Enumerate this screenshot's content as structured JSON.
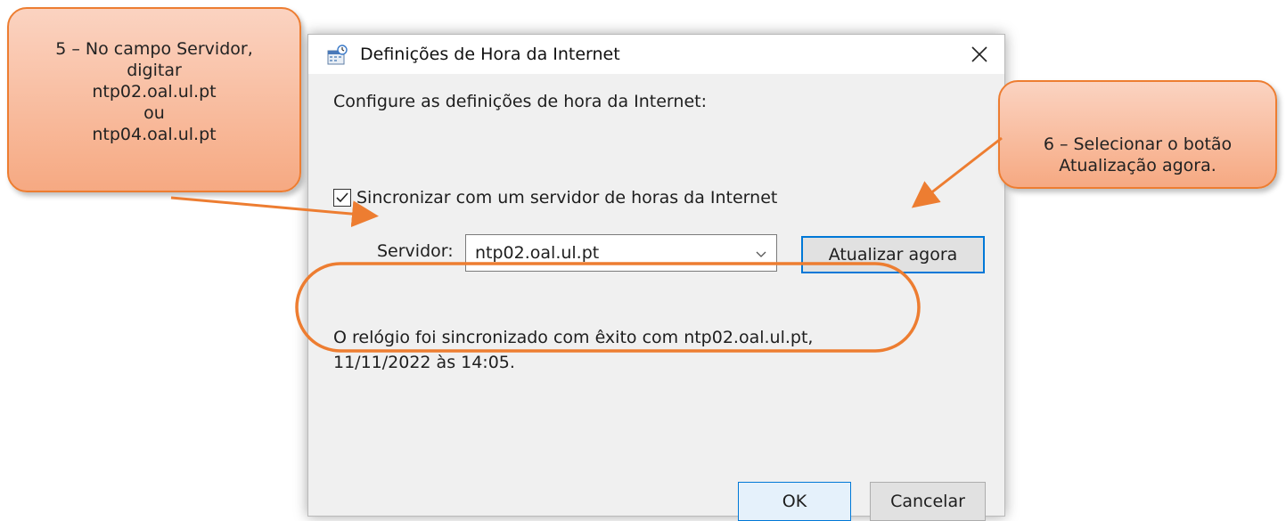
{
  "dialog": {
    "title": "Definições de Hora da Internet",
    "close_label": "✕",
    "intro_text": "Configure as definições de hora da Internet:",
    "sync_checkbox": {
      "label": "Sincronizar com um servidor de horas da Internet",
      "checked": true
    },
    "server_label": "Servidor:",
    "server_value": "ntp02.oal.ul.pt",
    "update_button": "Atualizar agora",
    "status_line1": "O relógio foi sincronizado com êxito com ntp02.oal.ul.pt,",
    "status_line2": "11/11/2022 às 14:05.",
    "ok_button": "OK",
    "cancel_button": "Cancelar"
  },
  "callouts": {
    "step5": {
      "line1": "5 – No campo Servidor,",
      "line2": "digitar",
      "line3": "ntp02.oal.ul.pt",
      "line4": "ou",
      "line5": "ntp04.oal.ul.pt"
    },
    "step6": {
      "line1": "6 – Selecionar o botão",
      "line2": "Atualização agora."
    }
  },
  "colors": {
    "accent": "#0078d7",
    "callout_border": "#ed7d31",
    "callout_fill": "#f6a982",
    "dialog_bg": "#f0f0f0"
  },
  "icons": [
    "clock-globe-icon",
    "close-icon",
    "check-icon",
    "chevron-down-icon"
  ]
}
